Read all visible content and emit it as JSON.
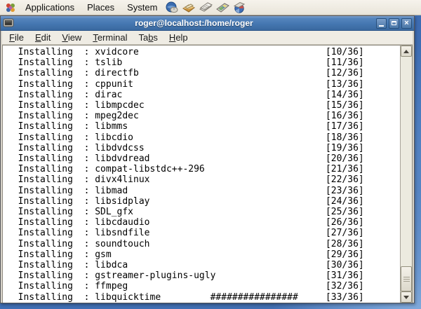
{
  "panel": {
    "menus": [
      {
        "label": "Applications"
      },
      {
        "label": "Places"
      },
      {
        "label": "System"
      }
    ],
    "launcher_icons": [
      "web-browser",
      "email-client",
      "documents-writer",
      "display-impress",
      "globe-chart"
    ],
    "logo_icon": "distro-flower-logo"
  },
  "window": {
    "title": "roger@localhost:/home/roger",
    "icon": "terminal-icon",
    "controls": [
      "minimize",
      "maximize",
      "close"
    ],
    "menubar": [
      {
        "label": "File",
        "mnemonic": 0
      },
      {
        "label": "Edit",
        "mnemonic": 0
      },
      {
        "label": "View",
        "mnemonic": 0
      },
      {
        "label": "Terminal",
        "mnemonic": 0
      },
      {
        "label": "Tabs",
        "mnemonic": 2
      },
      {
        "label": "Help",
        "mnemonic": 0
      }
    ]
  },
  "terminal": {
    "line_prefix": "  Installing  : ",
    "counter_column": 58,
    "hash_column": 37,
    "lines": [
      {
        "package": "xvidcore",
        "counter": "[10/36]"
      },
      {
        "package": "tslib",
        "counter": "[11/36]"
      },
      {
        "package": "directfb",
        "counter": "[12/36]"
      },
      {
        "package": "cppunit",
        "counter": "[13/36]"
      },
      {
        "package": "dirac",
        "counter": "[14/36]"
      },
      {
        "package": "libmpcdec",
        "counter": "[15/36]"
      },
      {
        "package": "mpeg2dec",
        "counter": "[16/36]"
      },
      {
        "package": "libmms",
        "counter": "[17/36]"
      },
      {
        "package": "libcdio",
        "counter": "[18/36]"
      },
      {
        "package": "libdvdcss",
        "counter": "[19/36]"
      },
      {
        "package": "libdvdread",
        "counter": "[20/36]"
      },
      {
        "package": "compat-libstdc++-296",
        "counter": "[21/36]"
      },
      {
        "package": "divx4linux",
        "counter": "[22/36]"
      },
      {
        "package": "libmad",
        "counter": "[23/36]"
      },
      {
        "package": "libsidplay",
        "counter": "[24/36]"
      },
      {
        "package": "SDL_gfx",
        "counter": "[25/36]"
      },
      {
        "package": "libcdaudio",
        "counter": "[26/36]"
      },
      {
        "package": "libsndfile",
        "counter": "[27/36]"
      },
      {
        "package": "soundtouch",
        "counter": "[28/36]"
      },
      {
        "package": "gsm",
        "counter": "[29/36]"
      },
      {
        "package": "libdca",
        "counter": "[30/36]"
      },
      {
        "package": "gstreamer-plugins-ugly",
        "counter": "[31/36]"
      },
      {
        "package": "ffmpeg",
        "counter": "[32/36]"
      },
      {
        "package": "libquicktime",
        "hashes": "################",
        "counter": "[33/36]"
      }
    ]
  },
  "colors": {
    "desktop_blue": "#3f6fb6",
    "panel_bg": "#efebe2",
    "titlebar_blue": "#4577b1",
    "terminal_bg": "#ffffff",
    "terminal_fg": "#000000"
  }
}
